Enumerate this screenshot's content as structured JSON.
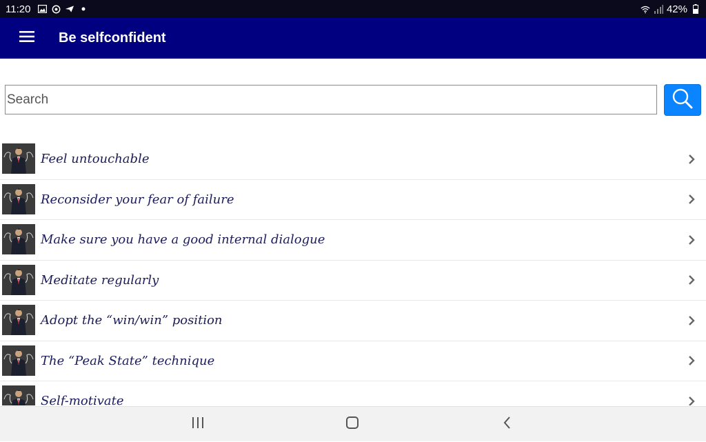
{
  "status_bar": {
    "time": "11:20",
    "battery": "42%",
    "icons": [
      "image-icon",
      "sync-icon",
      "send-icon",
      "dot-icon",
      "wifi-icon",
      "signal-icon",
      "battery-icon"
    ]
  },
  "app_bar": {
    "title": "Be selfconfident",
    "menu_icon": "hamburger-menu-icon",
    "color": "#000080"
  },
  "search": {
    "placeholder": "Search",
    "value": "",
    "button_icon": "search-icon",
    "button_color": "#0a84ff"
  },
  "list": {
    "items": [
      {
        "label": "Feel untouchable"
      },
      {
        "label": "Reconsider your fear of failure"
      },
      {
        "label": "Make sure you have a good internal dialogue"
      },
      {
        "label": "Meditate regularly"
      },
      {
        "label": "Adopt the “win/win” position"
      },
      {
        "label": "The “Peak State” technique"
      },
      {
        "label": "Self-motivate"
      }
    ],
    "thumbnail": "confident-man-thumbnail",
    "chevron_icon": "chevron-right-icon",
    "text_color": "#1c1c5a"
  },
  "nav_bar": {
    "buttons": [
      "recent-apps-icon",
      "home-icon",
      "back-icon"
    ]
  }
}
